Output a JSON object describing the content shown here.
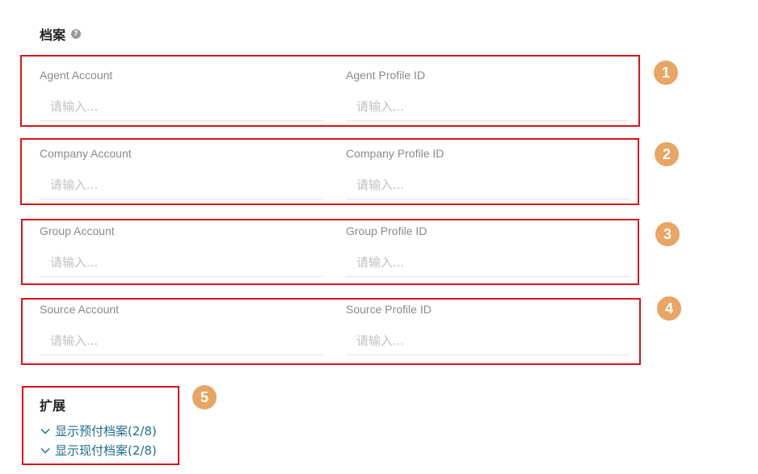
{
  "section": {
    "title": "档案"
  },
  "groups": [
    {
      "badge": "1",
      "fields": [
        {
          "label": "Agent Account",
          "placeholder": "请输入..."
        },
        {
          "label": "Agent Profile ID",
          "placeholder": "请输入..."
        }
      ]
    },
    {
      "badge": "2",
      "fields": [
        {
          "label": "Company Account",
          "placeholder": "请输入..."
        },
        {
          "label": "Company Profile ID",
          "placeholder": "请输入..."
        }
      ]
    },
    {
      "badge": "3",
      "fields": [
        {
          "label": "Group Account",
          "placeholder": "请输入..."
        },
        {
          "label": "Group Profile ID",
          "placeholder": "请输入..."
        }
      ]
    },
    {
      "badge": "4",
      "fields": [
        {
          "label": "Source Account",
          "placeholder": "请输入..."
        },
        {
          "label": "Source Profile ID",
          "placeholder": "请输入..."
        }
      ]
    }
  ],
  "extension": {
    "badge": "5",
    "title": "扩展",
    "links": [
      {
        "label": "显示预付档案(2/8)"
      },
      {
        "label": "显示现付档案(2/8)"
      }
    ]
  },
  "colors": {
    "highlight_border": "#d9141b",
    "badge": "#e8a563",
    "link": "#1f6e8c"
  }
}
